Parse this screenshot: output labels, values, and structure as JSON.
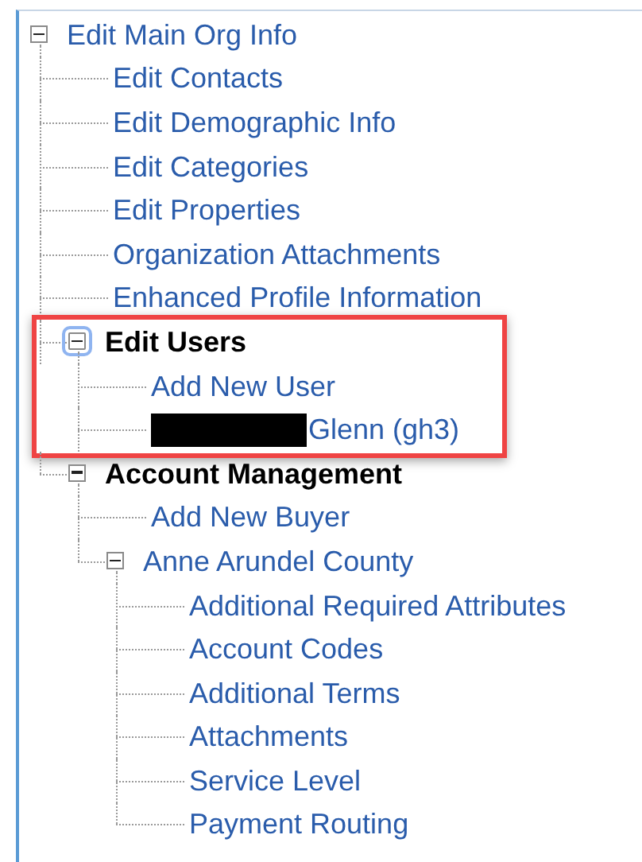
{
  "tree": [
    {
      "label": "Edit Main Org Info",
      "kind": "link",
      "expanded": true,
      "children": [
        {
          "label": "Edit Contacts",
          "kind": "link"
        },
        {
          "label": "Edit Demographic Info",
          "kind": "link"
        },
        {
          "label": "Edit Categories",
          "kind": "link"
        },
        {
          "label": "Edit Properties",
          "kind": "link"
        },
        {
          "label": "Organization Attachments",
          "kind": "link"
        },
        {
          "label": "Enhanced Profile Information",
          "kind": "link"
        },
        {
          "label": "Edit Users",
          "kind": "section",
          "expanded": true,
          "focused": true,
          "highlighted": true,
          "children": [
            {
              "label": "Add New User",
              "kind": "link"
            },
            {
              "label": "Glenn (gh3)",
              "kind": "link",
              "redacted": true
            }
          ]
        },
        {
          "label": "Account Management",
          "kind": "section",
          "expanded": true,
          "children": [
            {
              "label": "Add New Buyer",
              "kind": "link"
            },
            {
              "label": "Anne Arundel County",
              "kind": "link",
              "expanded": true,
              "children": [
                {
                  "label": "Additional Required Attributes",
                  "kind": "link"
                },
                {
                  "label": "Account Codes",
                  "kind": "link"
                },
                {
                  "label": "Additional Terms",
                  "kind": "link"
                },
                {
                  "label": "Attachments",
                  "kind": "link"
                },
                {
                  "label": "Service Level",
                  "kind": "link"
                },
                {
                  "label": "Payment Routing",
                  "kind": "link"
                }
              ]
            }
          ]
        }
      ]
    }
  ]
}
